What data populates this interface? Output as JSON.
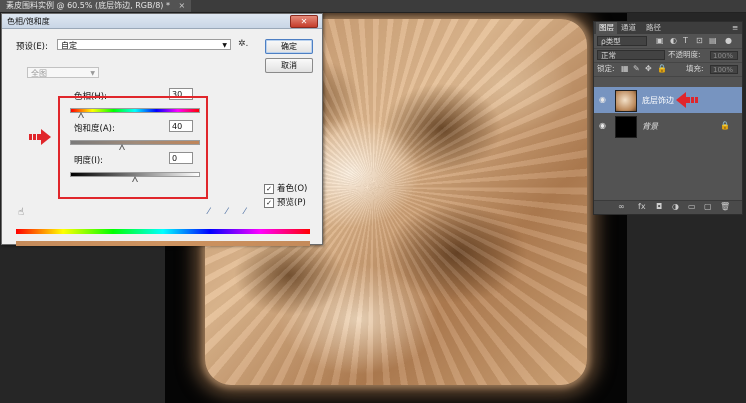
{
  "document_tab": {
    "title": "素皮围料实例 @ 60.5% (底层饰边, RGB/8) *",
    "close": "×"
  },
  "dialog": {
    "title": "色相/饱和度",
    "close": "✕",
    "preset_label": "预设(E):",
    "preset_value": "自定",
    "channel_value": "全图",
    "ok_label": "确定",
    "cancel_label": "取消",
    "hue": {
      "label": "色相(H):",
      "value": "30",
      "slider_fraction": 0.08
    },
    "saturation": {
      "label": "饱和度(A):",
      "value": "40",
      "slider_fraction": 0.4
    },
    "lightness": {
      "label": "明度(I):",
      "value": "0",
      "slider_fraction": 0.5
    },
    "colorize": {
      "label": "着色(O)",
      "checked": true
    },
    "preview": {
      "label": "预览(P)",
      "checked": true
    }
  },
  "layers_panel": {
    "tabs": [
      "图层",
      "通道",
      "路径"
    ],
    "kind_filter": "ρ类型",
    "blend_mode": "正常",
    "opacity_label": "不透明度:",
    "opacity_value": "100%",
    "lock_label": "锁定:",
    "fill_label": "填充:",
    "fill_value": "100%",
    "layers": [
      {
        "name": "底层饰边",
        "active": true
      },
      {
        "name": "背景",
        "locked": true
      }
    ]
  },
  "colors": {
    "highlight_red": "#e0262b",
    "layer_selected": "#7794c0",
    "fur_brown": "#b47f52"
  }
}
